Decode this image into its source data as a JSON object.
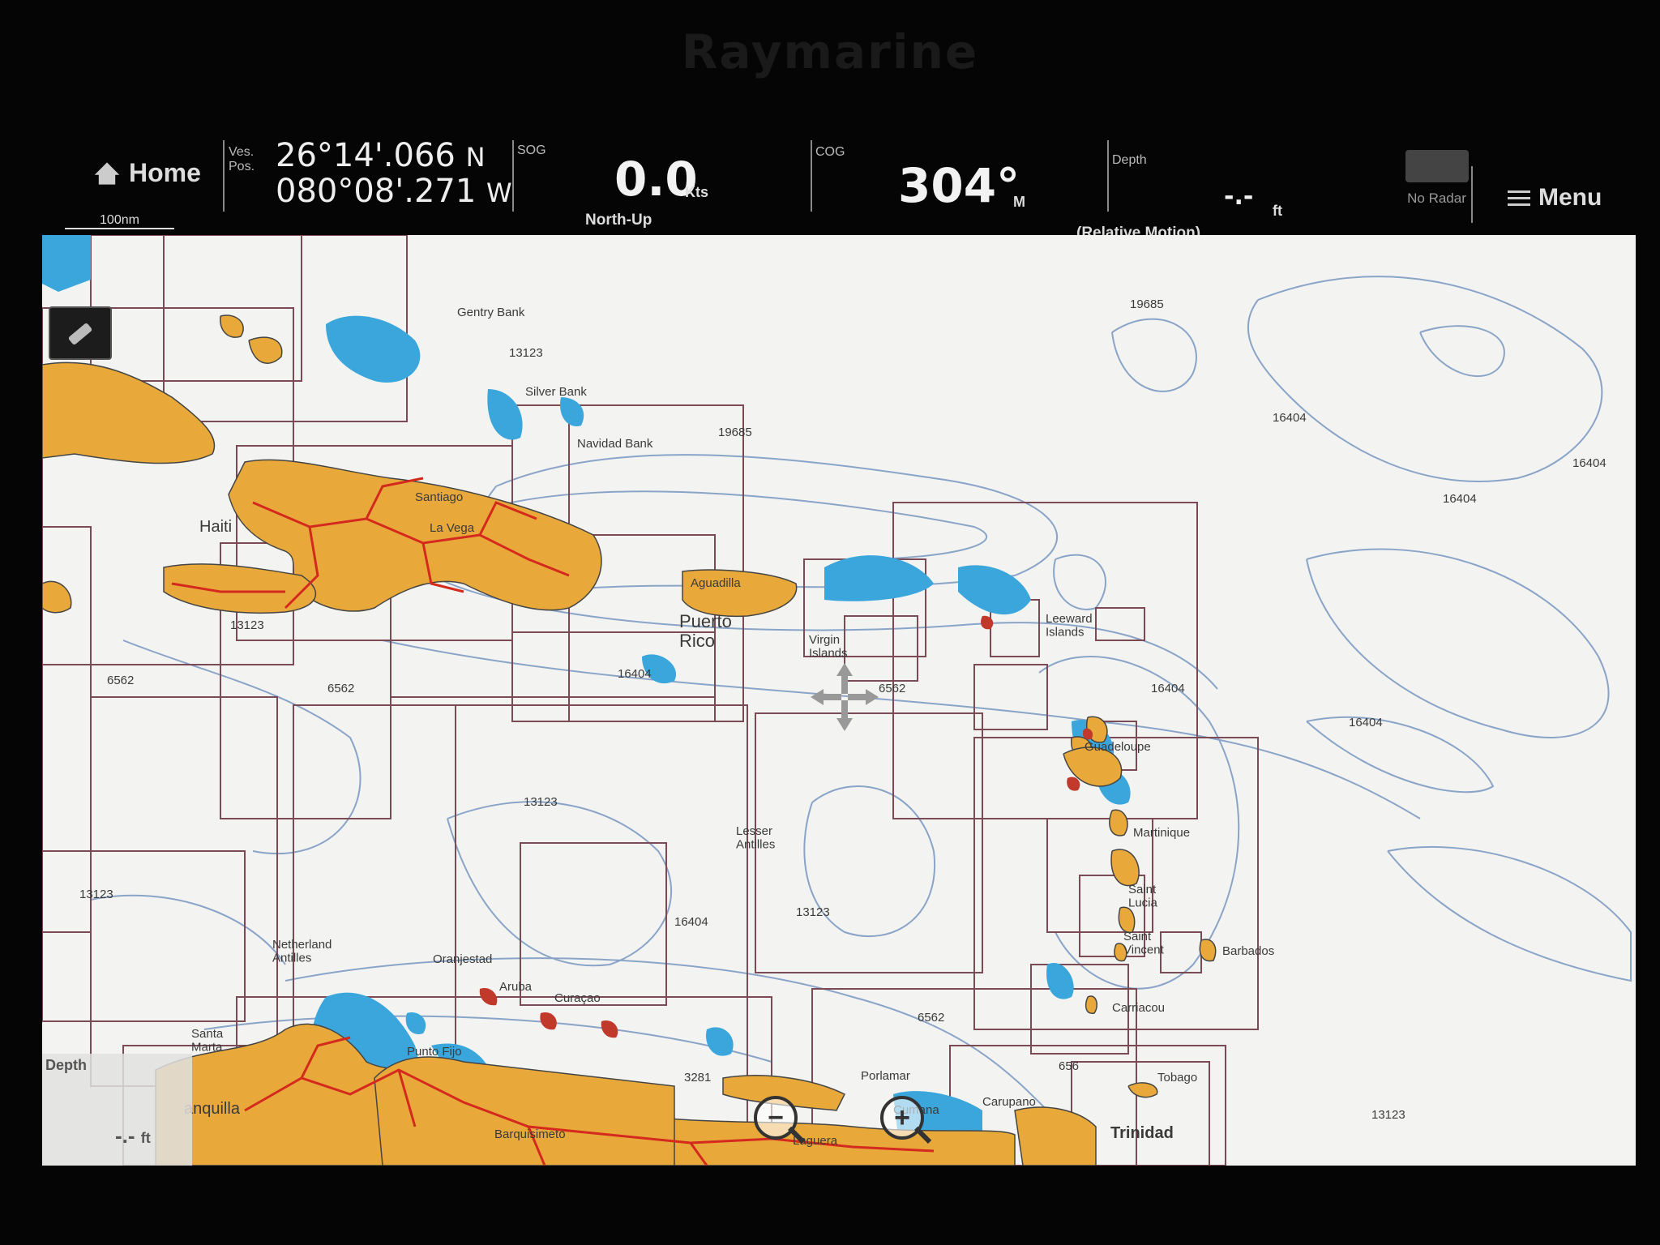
{
  "device": {
    "brand": "Raymarine"
  },
  "topbar": {
    "home_label": "Home",
    "scale_label": "100nm",
    "vespos_label": "Ves.\nPos.",
    "latitude": "26°14'.066",
    "lat_hemisphere": "N",
    "longitude": "080°08'.271",
    "lon_hemisphere": "W",
    "sog_label": "SOG",
    "sog_value": "0.0",
    "sog_unit": "Kts",
    "orientation_mode": "North-Up",
    "cog_label": "COG",
    "cog_value": "304°",
    "cog_unit": "M",
    "depth_label": "Depth",
    "depth_value": "-.-",
    "depth_unit": "ft",
    "motion_mode": "(Relative Motion)",
    "radar_status": "No Radar",
    "menu_label": "Menu"
  },
  "chart": {
    "labels": {
      "gentry_bank": "Gentry Bank",
      "silver_bank": "Silver Bank",
      "navidad_bank": "Navidad Bank",
      "haiti": "Haiti",
      "santiago": "Santiago",
      "la_vega": "La Vega",
      "aguadilla": "Aguadilla",
      "puerto_rico": "Puerto\nRico",
      "virgin_islands": "Virgin\nIslands",
      "leeward": "Leeward\nIslands",
      "lesser_antilles": "Lesser\nAntilles",
      "guadeloupe": "Guadeloupe",
      "martinique": "Martinique",
      "saint_lucia": "Saint\nLucia",
      "saint_vincent": "Saint\nVincent",
      "carriacou": "Carriacou",
      "barbados": "Barbados",
      "tobago": "Tobago",
      "trinidad": "Trinidad",
      "netherland_antilles": "Netherland\nAntilles",
      "oranjestad": "Oranjestad",
      "aruba": "Aruba",
      "curacao": "Curaçao",
      "porlamar": "Porlamar",
      "carupano": "Carupano",
      "cumana": "Cumana",
      "santa_marta": "Santa\nMarta",
      "punto_fijo": "Punto Fijo",
      "barranquilla": "anquilla",
      "barquisimeto": "Barquisimeto",
      "la_guaira": "Laguera"
    },
    "chart_numbers": {
      "n_19685_a": "19685",
      "n_19685_b": "19685",
      "n_16404_a": "16404",
      "n_16404_b": "16404",
      "n_16404_c": "16404",
      "n_16404_d": "16404",
      "n_16404_e": "16404",
      "n_16404_f": "16404",
      "n_16404_g": "16404",
      "n_13123_a": "13123",
      "n_13123_b": "13123",
      "n_13123_c": "13123",
      "n_13123_d": "13123",
      "n_13123_e": "13123",
      "n_13123_f": "13123",
      "n_6562_a": "6562",
      "n_6562_b": "6562",
      "n_6562_c": "6562",
      "n_6562_d": "6562",
      "n_656": "656",
      "n_3281": "3281"
    },
    "depth_box": {
      "label": "Depth",
      "value": "-.-",
      "unit": "ft"
    },
    "colors": {
      "land": "#e8a93a",
      "shallow_water": "#3aa6dc",
      "contour": "#8aa4c8",
      "chart_border": "#7a4a55",
      "roads": "#d42a1e"
    }
  }
}
